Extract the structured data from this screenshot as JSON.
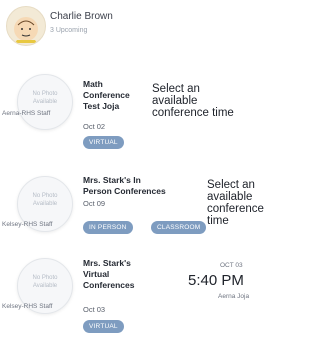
{
  "user": {
    "name": "Charlie Brown",
    "subtitle": "3 Upcoming"
  },
  "placeholder_label": "No Photo\nAvailable",
  "conferences": [
    {
      "staff": "Aerna-RHS Staff",
      "title": "Math\nConference\nTest Joja",
      "date": "Oct 02",
      "badges": [
        "VIRTUAL"
      ],
      "status": "Select an\navailable\nconference time"
    },
    {
      "staff": "Kelsey-RHS Staff",
      "title": "Mrs. Stark's In\nPerson Conferences",
      "date": "Oct 09",
      "badges": [
        "IN PERSON",
        "CLASSROOM"
      ],
      "status": "Select an\navailable\nconference\ntime"
    },
    {
      "staff": "Kelsey-RHS Staff",
      "title": "Mrs. Stark's\nVirtual\nConferences",
      "date": "Oct 03",
      "badges": [
        "VIRTUAL"
      ],
      "time": {
        "date": "OCT 03",
        "value": "5:40 PM",
        "host": "Aerna Joja"
      }
    }
  ]
}
